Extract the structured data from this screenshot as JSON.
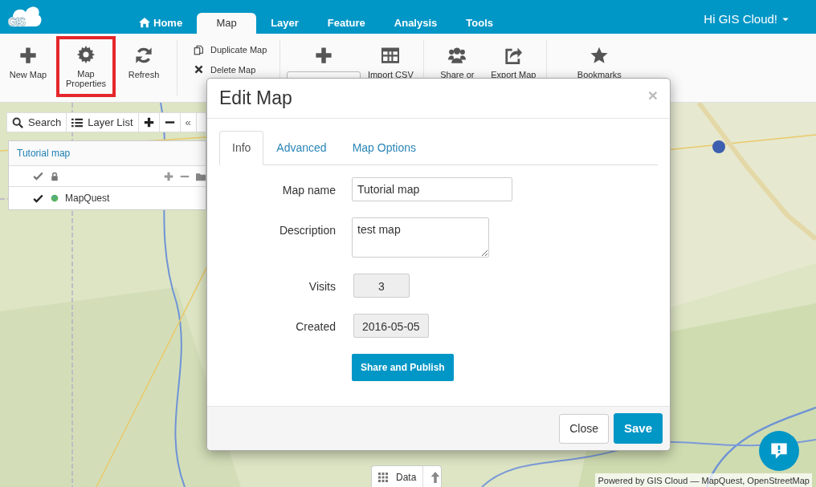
{
  "app": {
    "logo": "GIS",
    "user_menu": "Hi GIS Cloud!",
    "tabs": [
      {
        "label": "Home",
        "selected": false
      },
      {
        "label": "Map",
        "selected": true
      },
      {
        "label": "Layer",
        "selected": false
      },
      {
        "label": "Feature",
        "selected": false
      },
      {
        "label": "Analysis",
        "selected": false
      },
      {
        "label": "Tools",
        "selected": false
      }
    ]
  },
  "toolbar": {
    "groups": [
      {
        "items": [
          {
            "kind": "big",
            "label": "New Map",
            "highlighted": false
          },
          {
            "kind": "big",
            "label": "Map Properties",
            "highlighted": true
          },
          {
            "kind": "big",
            "label": "Refresh",
            "highlighted": false
          }
        ]
      },
      {
        "items": [
          {
            "kind": "small",
            "label": "Duplicate Map"
          },
          {
            "kind": "small",
            "label": "Delete Map"
          }
        ]
      },
      {
        "items": [
          {
            "kind": "split"
          },
          {
            "kind": "big",
            "label": "Import CSV",
            "highlighted": false
          }
        ]
      },
      {
        "items": [
          {
            "kind": "big",
            "label": "Share or",
            "highlighted": false
          },
          {
            "kind": "big",
            "label": "Export Map",
            "highlighted": false
          }
        ]
      },
      {
        "items": [
          {
            "kind": "big",
            "label": "Bookmarks",
            "highlighted": false
          }
        ]
      }
    ]
  },
  "layer_panel": {
    "search": "Search",
    "layer_list": "Layer List",
    "collapse": "«",
    "map_title": "Tutorial map",
    "layers": [
      {
        "name": "MapQuest",
        "checked": true
      }
    ]
  },
  "dialog": {
    "title": "Edit Map",
    "close": "×",
    "tabs": [
      {
        "label": "Info",
        "selected": true
      },
      {
        "label": "Advanced",
        "selected": false
      },
      {
        "label": "Map Options",
        "selected": false
      }
    ],
    "fields": [
      {
        "label": "Map name",
        "kind": "text",
        "value": "Tutorial map"
      },
      {
        "label": "Description",
        "kind": "textarea",
        "value": "test map"
      },
      {
        "label": "Visits",
        "kind": "readonly",
        "value": "3"
      },
      {
        "label": "Created",
        "kind": "readonly",
        "value": "2016-05-05"
      }
    ],
    "action": "Share and Publish",
    "buttons": [
      {
        "label": "Close",
        "kind": "default"
      },
      {
        "label": "Save",
        "kind": "primary"
      }
    ]
  },
  "data_bar": {
    "label": "Data"
  },
  "attribution": "Powered by GIS Cloud — MapQuest, OpenStreetMap"
}
